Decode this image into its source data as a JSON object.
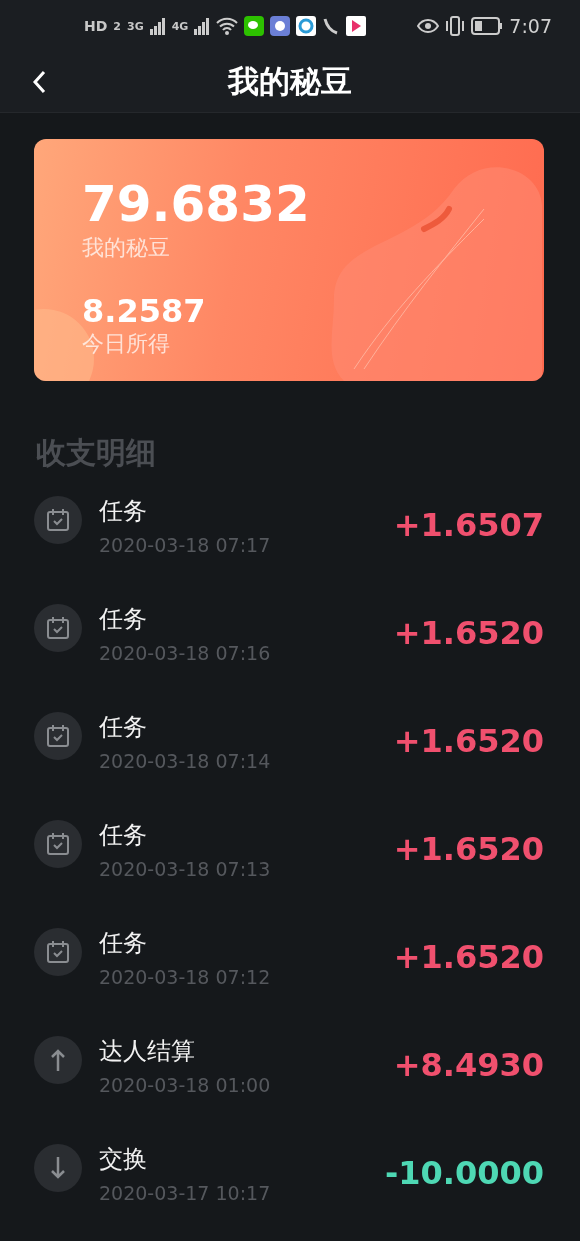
{
  "status_bar": {
    "network": [
      "HD",
      "2",
      "3G",
      "4G"
    ],
    "time": "7:07"
  },
  "header": {
    "title": "我的秘豆"
  },
  "card": {
    "balance": "79.6832",
    "balance_label": "我的秘豆",
    "today": "8.2587",
    "today_label": "今日所得"
  },
  "section_title": "收支明细",
  "records": [
    {
      "kind": "task",
      "title": "任务",
      "time": "2020-03-18 07:17",
      "amount": "+1.6507",
      "color": "#f0506e"
    },
    {
      "kind": "task",
      "title": "任务",
      "time": "2020-03-18 07:16",
      "amount": "+1.6520",
      "color": "#f0506e"
    },
    {
      "kind": "task",
      "title": "任务",
      "time": "2020-03-18 07:14",
      "amount": "+1.6520",
      "color": "#f0506e"
    },
    {
      "kind": "task",
      "title": "任务",
      "time": "2020-03-18 07:13",
      "amount": "+1.6520",
      "color": "#f0506e"
    },
    {
      "kind": "task",
      "title": "任务",
      "time": "2020-03-18 07:12",
      "amount": "+1.6520",
      "color": "#f0506e"
    },
    {
      "kind": "up",
      "title": "达人结算",
      "time": "2020-03-18 01:00",
      "amount": "+8.4930",
      "color": "#f0506e"
    },
    {
      "kind": "down",
      "title": "交换",
      "time": "2020-03-17 10:17",
      "amount": "-10.0000",
      "color": "#4ed8b4"
    }
  ]
}
